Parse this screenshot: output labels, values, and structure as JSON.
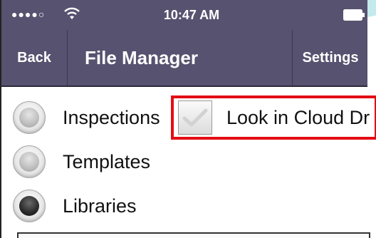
{
  "status_bar": {
    "signal": "●●●●○",
    "time": "10:47 AM"
  },
  "nav": {
    "back_label": "Back",
    "title": "File Manager",
    "settings_label": "Settings"
  },
  "options": {
    "inspections": {
      "label": "Inspections",
      "selected": false
    },
    "templates": {
      "label": "Templates",
      "selected": false
    },
    "libraries": {
      "label": "Libraries",
      "selected": true
    }
  },
  "cloud": {
    "label": "Look in Cloud Dr",
    "checked": false
  },
  "colors": {
    "nav_background": "#57526f",
    "highlight_border": "#e30d14"
  }
}
